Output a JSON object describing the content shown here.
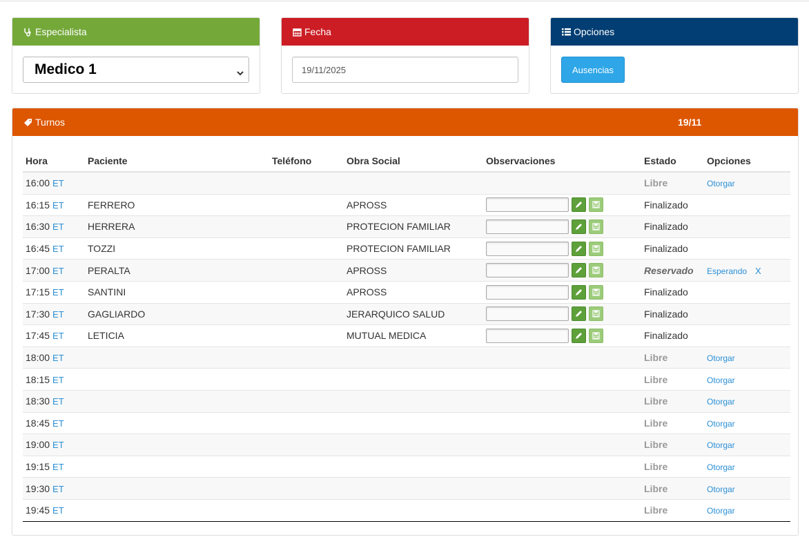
{
  "panels": {
    "especialista": {
      "title": "Especialista",
      "selected": "Medico 1",
      "color": "#74a93a"
    },
    "fecha": {
      "title": "Fecha",
      "value": "19/11/2025",
      "color": "#cc1d24"
    },
    "opciones": {
      "title": "Opciones",
      "button": "Ausencias",
      "color": "#023e73"
    },
    "turnos": {
      "title": "Turnos",
      "date": "19/11",
      "color": "#dd5600"
    }
  },
  "table": {
    "headers": [
      "Hora",
      "Paciente",
      "Teléfono",
      "Obra Social",
      "Observaciones",
      "Estado",
      "Opciones"
    ],
    "et_label": "ET",
    "rows": [
      {
        "hora": "16:00",
        "paciente": "",
        "telefono": "",
        "obra": "",
        "obs": false,
        "estado": "Libre",
        "estado_type": "libre",
        "op1": "Otorgar",
        "op2": ""
      },
      {
        "hora": "16:15",
        "paciente": "FERRERO",
        "telefono": "",
        "obra": "APROSS",
        "obs": true,
        "estado": "Finalizado",
        "estado_type": "normal",
        "op1": "",
        "op2": ""
      },
      {
        "hora": "16:30",
        "paciente": "HERRERA",
        "telefono": "",
        "obra": "PROTECION FAMILIAR",
        "obs": true,
        "estado": "Finalizado",
        "estado_type": "normal",
        "op1": "",
        "op2": ""
      },
      {
        "hora": "16:45",
        "paciente": "TOZZI",
        "telefono": "",
        "obra": "PROTECION FAMILIAR",
        "obs": true,
        "estado": "Finalizado",
        "estado_type": "normal",
        "op1": "",
        "op2": ""
      },
      {
        "hora": "17:00",
        "paciente": "PERALTA",
        "telefono": "",
        "obra": "APROSS",
        "obs": true,
        "estado": "Reservado",
        "estado_type": "reservado",
        "op1": "Esperando",
        "op2": "X"
      },
      {
        "hora": "17:15",
        "paciente": "SANTINI",
        "telefono": "",
        "obra": "APROSS",
        "obs": true,
        "estado": "Finalizado",
        "estado_type": "normal",
        "op1": "",
        "op2": ""
      },
      {
        "hora": "17:30",
        "paciente": "GAGLIARDO",
        "telefono": "",
        "obra": "JERARQUICO SALUD",
        "obs": true,
        "estado": "Finalizado",
        "estado_type": "normal",
        "op1": "",
        "op2": ""
      },
      {
        "hora": "17:45",
        "paciente": "LETICIA",
        "telefono": "",
        "obra": "MUTUAL MEDICA",
        "obs": true,
        "estado": "Finalizado",
        "estado_type": "normal",
        "op1": "",
        "op2": ""
      },
      {
        "hora": "18:00",
        "paciente": "",
        "telefono": "",
        "obra": "",
        "obs": false,
        "estado": "Libre",
        "estado_type": "libre",
        "op1": "Otorgar",
        "op2": ""
      },
      {
        "hora": "18:15",
        "paciente": "",
        "telefono": "",
        "obra": "",
        "obs": false,
        "estado": "Libre",
        "estado_type": "libre",
        "op1": "Otorgar",
        "op2": ""
      },
      {
        "hora": "18:30",
        "paciente": "",
        "telefono": "",
        "obra": "",
        "obs": false,
        "estado": "Libre",
        "estado_type": "libre",
        "op1": "Otorgar",
        "op2": ""
      },
      {
        "hora": "18:45",
        "paciente": "",
        "telefono": "",
        "obra": "",
        "obs": false,
        "estado": "Libre",
        "estado_type": "libre",
        "op1": "Otorgar",
        "op2": ""
      },
      {
        "hora": "19:00",
        "paciente": "",
        "telefono": "",
        "obra": "",
        "obs": false,
        "estado": "Libre",
        "estado_type": "libre",
        "op1": "Otorgar",
        "op2": ""
      },
      {
        "hora": "19:15",
        "paciente": "",
        "telefono": "",
        "obra": "",
        "obs": false,
        "estado": "Libre",
        "estado_type": "libre",
        "op1": "Otorgar",
        "op2": ""
      },
      {
        "hora": "19:30",
        "paciente": "",
        "telefono": "",
        "obra": "",
        "obs": false,
        "estado": "Libre",
        "estado_type": "libre",
        "op1": "Otorgar",
        "op2": ""
      },
      {
        "hora": "19:45",
        "paciente": "",
        "telefono": "",
        "obra": "",
        "obs": false,
        "estado": "Libre",
        "estado_type": "libre",
        "op1": "Otorgar",
        "op2": ""
      }
    ]
  },
  "icons": {
    "especialista": "stethoscope-icon",
    "fecha": "calendar-icon",
    "opciones": "list-icon",
    "turnos": "ticket-icon",
    "edit": "pencil-icon",
    "save": "floppy-disk-icon"
  }
}
